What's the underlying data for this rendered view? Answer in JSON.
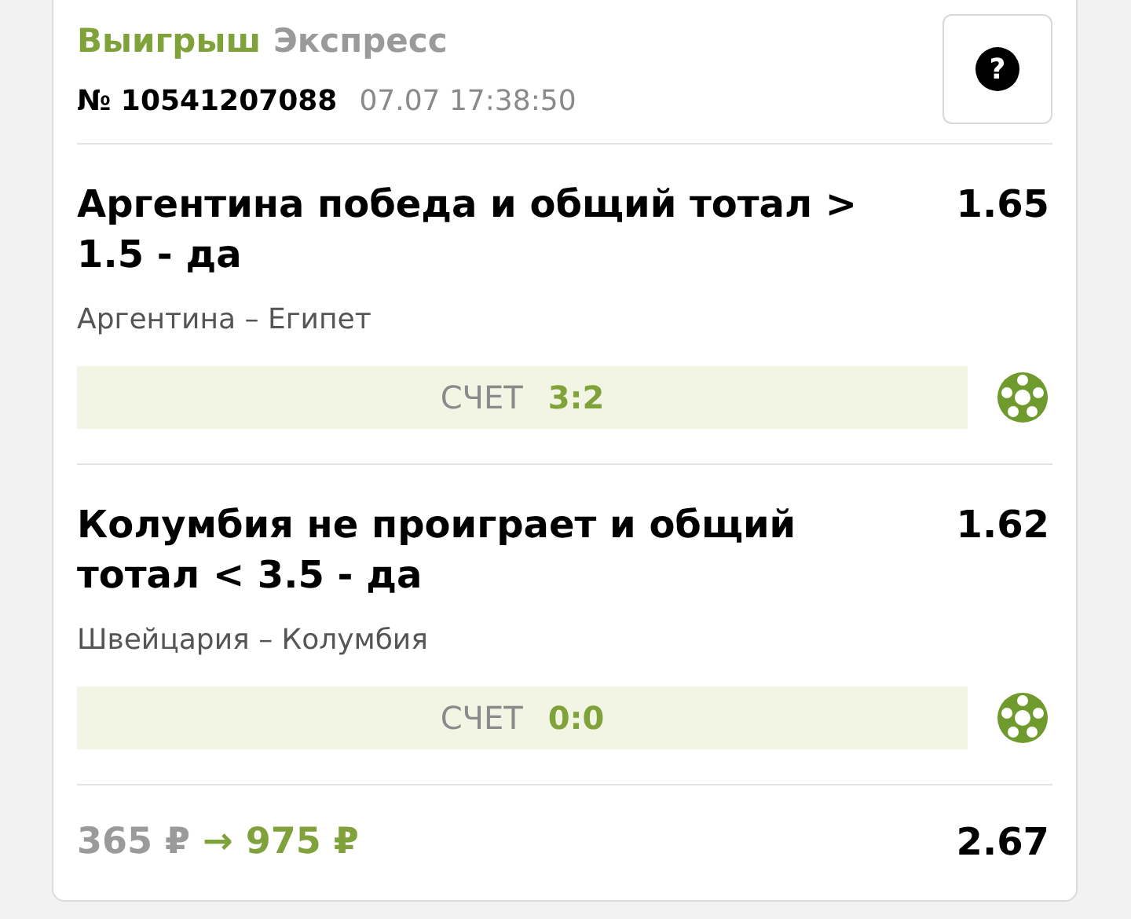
{
  "header": {
    "status": "Выигрыш",
    "type": "Экспресс",
    "number": "№ 10541207088",
    "datetime": "07.07 17:38:50",
    "help": "?"
  },
  "bets": [
    {
      "title": "Аргентина победа и общий тотал > 1.5 - да",
      "odds": "1.65",
      "match": "Аргентина – Египет",
      "score_label": "СЧЕТ",
      "score": "3:2",
      "won": true
    },
    {
      "title": "Колумбия не проиграет и общий тотал < 3.5 - да",
      "odds": "1.62",
      "match": "Швейцария – Колумбия",
      "score_label": "СЧЕТ",
      "score": "0:0",
      "won": true
    }
  ],
  "footer": {
    "stake": "365 ₽",
    "arrow": "→",
    "payout": "975 ₽",
    "total_odds": "2.67"
  }
}
